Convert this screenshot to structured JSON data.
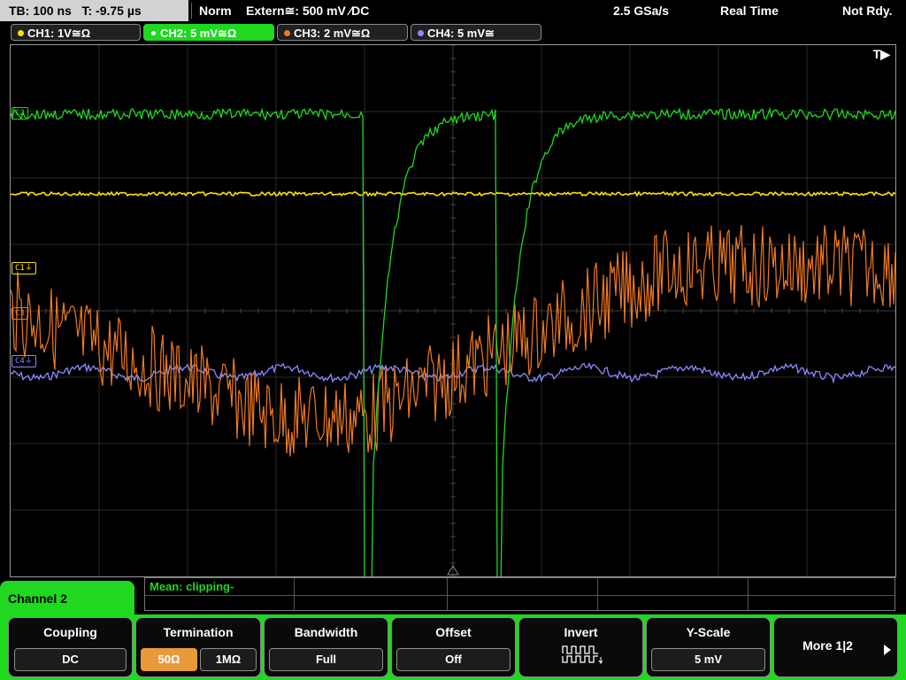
{
  "status_bar": {
    "timebase": "TB: 100 ns",
    "trigger_time": "T: -9.75 µs",
    "mode": "Norm",
    "trigger_source": "Extern≅: 500 mV ∕DC",
    "sample_rate": "2.5 GSa/s",
    "acq_mode": "Real Time",
    "ready_state": "Not Rdy."
  },
  "channel_tabs": [
    {
      "label": "CH1: 1V≅Ω",
      "color": "#ffe000"
    },
    {
      "label": "CH2: 5 mV≅Ω",
      "color": "#1fd81f"
    },
    {
      "label": "CH3: 2 mV≅Ω",
      "color": "#f07a20"
    },
    {
      "label": "CH4: 5 mV≅",
      "color": "#8a8aff"
    }
  ],
  "plot": {
    "trigger_indicator": "T▶",
    "markers": [
      {
        "label": "C2",
        "color": "#1fd81f"
      },
      {
        "label": "C1⏚",
        "color": "#ffe000"
      },
      {
        "label": "C3",
        "color": "#f07a20"
      },
      {
        "label": "C4⏚",
        "color": "#8a8aff"
      }
    ]
  },
  "measurement": {
    "label": "Mean: clipping-"
  },
  "menu_tab": {
    "label": "Channel 2"
  },
  "softkeys": {
    "coupling": {
      "title": "Coupling",
      "value": "DC"
    },
    "termination": {
      "title": "Termination",
      "options": [
        "50Ω",
        "1MΩ"
      ],
      "selected": "50Ω"
    },
    "bandwidth": {
      "title": "Bandwidth",
      "value": "Full"
    },
    "offset": {
      "title": "Offset",
      "value": "Off"
    },
    "invert": {
      "title": "Invert",
      "icon": "invert-waveform-icon"
    },
    "yscale": {
      "title": "Y-Scale",
      "value": "5 mV"
    },
    "more": {
      "label": "More 1|2"
    }
  },
  "colors": {
    "accent": "#1fd81f",
    "ch1": "#ffe000",
    "ch2": "#1fd81f",
    "ch3": "#f07a20",
    "ch4": "#8a8aff",
    "selected": "#e89a3a"
  }
}
